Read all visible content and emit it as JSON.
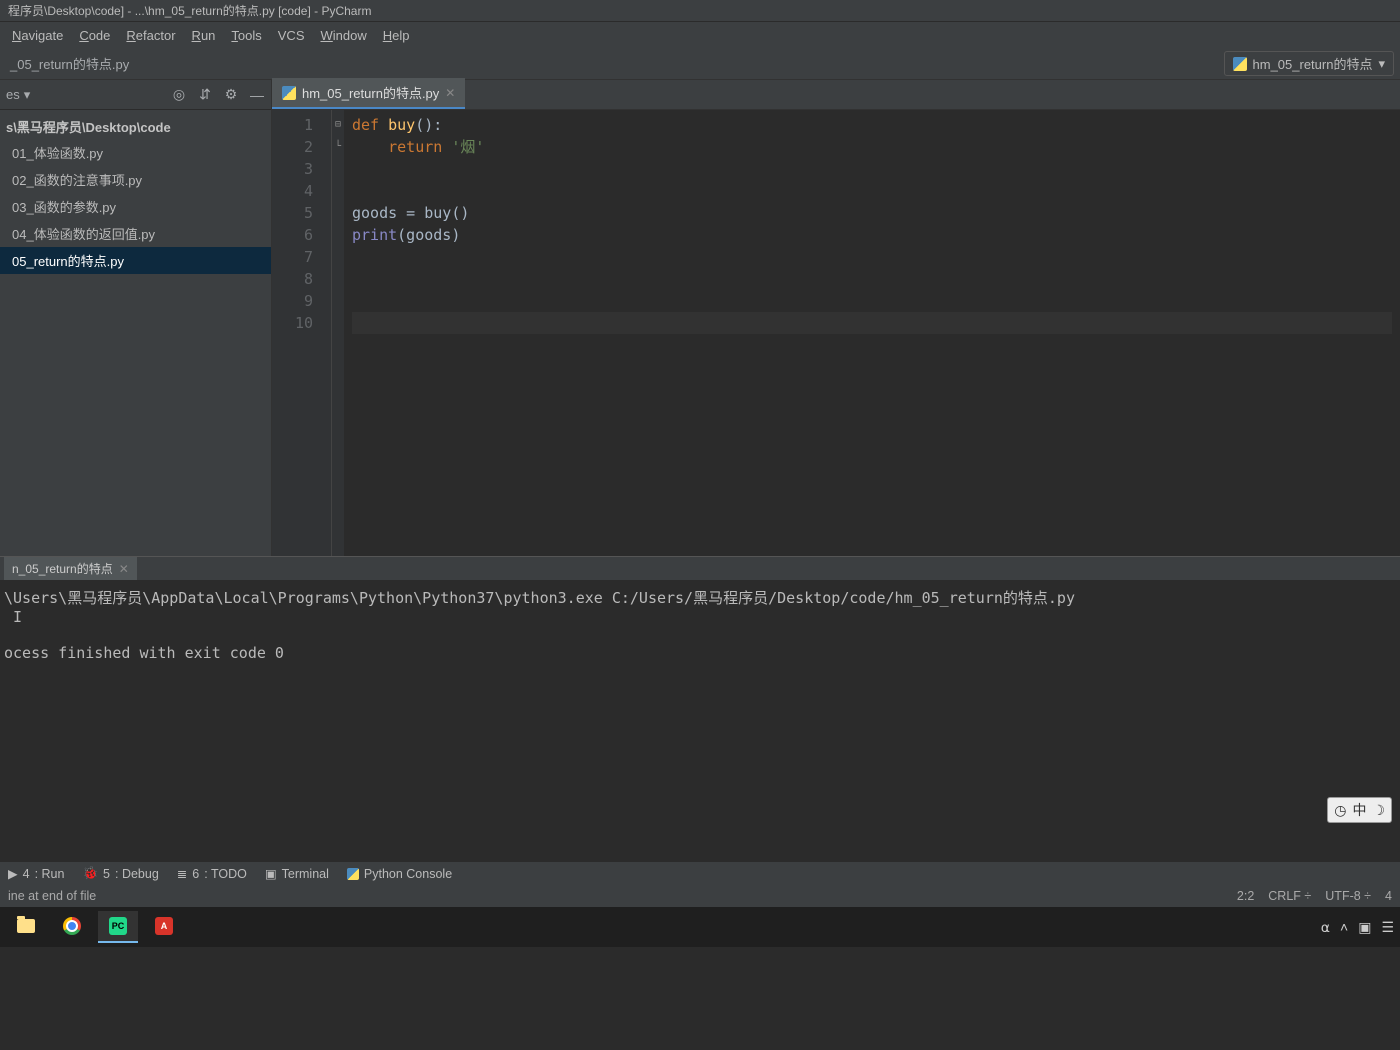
{
  "title_bar": "程序员\\Desktop\\code] - ...\\hm_05_return的特点.py [code] - PyCharm",
  "menu": {
    "navigate": "Navigate",
    "code": "Code",
    "refactor": "Refactor",
    "run": "Run",
    "tools": "Tools",
    "vcs": "VCS",
    "window": "Window",
    "help": "Help"
  },
  "nav": {
    "path": "_05_return的特点.py",
    "run_config": "hm_05_return的特点"
  },
  "sidebar": {
    "header": "es",
    "root": "s\\黑马程序员\\Desktop\\code",
    "items": [
      "01_体验函数.py",
      "02_函数的注意事项.py",
      "03_函数的参数.py",
      "04_体验函数的返回值.py",
      "05_return的特点.py"
    ],
    "selected_index": 4
  },
  "tab": {
    "label": "hm_05_return的特点.py"
  },
  "code": {
    "lines": [
      "1",
      "2",
      "3",
      "4",
      "5",
      "6",
      "7",
      "8",
      "9",
      "10"
    ],
    "l1_def": "def ",
    "l1_fn": "buy",
    "l1_rest": "():",
    "l2_ret": "    return ",
    "l2_str": "'烟'",
    "l5": "goods = buy()",
    "l6_print": "print",
    "l6_rest": "(goods)"
  },
  "run_panel": {
    "tab": "n_05_return的特点",
    "line1": "\\Users\\黑马程序员\\AppData\\Local\\Programs\\Python\\Python37\\python3.exe C:/Users/黑马程序员/Desktop/code/hm_05_return的特点.py",
    "cursor": " I",
    "line3": "ocess finished with exit code 0"
  },
  "bottom_tools": {
    "run": "4: Run",
    "debug": "5: Debug",
    "todo": "6: TODO",
    "terminal": "Terminal",
    "python_console": "Python Console"
  },
  "status": {
    "left": "ine at end of file",
    "pos": "2:2",
    "crlf": "CRLF",
    "enc": "UTF-8",
    "indent": "4"
  },
  "ime": {
    "lang": "中"
  }
}
